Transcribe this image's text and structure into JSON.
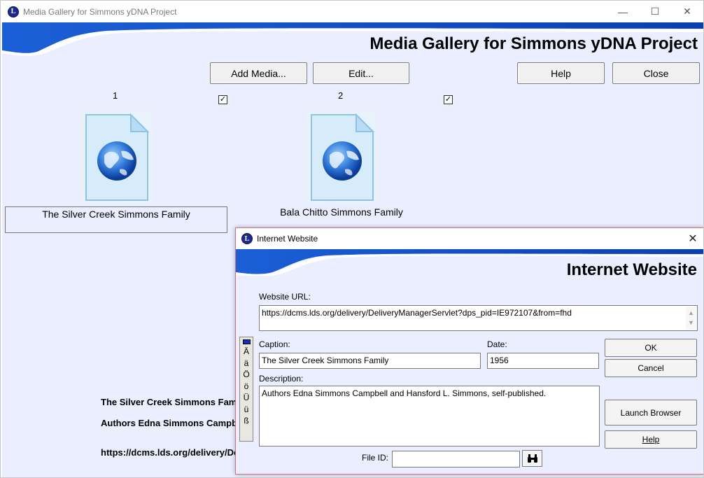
{
  "window": {
    "title": "Media Gallery for Simmons yDNA Project",
    "controls": {
      "minimize": "—",
      "maximize": "☐",
      "close": "✕"
    }
  },
  "gallery": {
    "banner_title": "Media Gallery for Simmons yDNA Project",
    "buttons": {
      "add_media": "Add Media...",
      "edit": "Edit...",
      "help": "Help",
      "close": "Close"
    },
    "items": [
      {
        "number": "1",
        "checked": "✓",
        "icon": "web-document-icon",
        "caption": "The Silver Creek Simmons Family"
      },
      {
        "number": "2",
        "checked": "✓",
        "icon": "web-document-icon",
        "caption": "Bala Chitto Simmons Family"
      }
    ],
    "details": {
      "line1": "The Silver Creek Simmons Family",
      "line2": "Authors Edna Simmons Campbell and Hansford L. Simmons, self-published.",
      "line3": "https://dcms.lds.org/delivery/DeliveryManagerServlet?dps_pid=IE972107&from=fhd"
    }
  },
  "dialog": {
    "title": "Internet Website",
    "banner_title": "Internet Website",
    "close": "✕",
    "url_label": "Website URL:",
    "url_value": "https://dcms.lds.org/delivery/DeliveryManagerServlet?dps_pid=IE972107&from=fhd",
    "caption_label": "Caption:",
    "caption_value": "The Silver Creek Simmons Family",
    "date_label": "Date:",
    "date_value": "1956",
    "description_label": "Description:",
    "description_value": "Authors Edna Simmons Campbell and Hansford L. Simmons, self-published.",
    "file_id_label": "File ID:",
    "file_id_value": "",
    "chars": [
      "Ä",
      "ä",
      "Ö",
      "ö",
      "Ü",
      "ü",
      "ß"
    ],
    "buttons": {
      "ok": "OK",
      "cancel": "Cancel",
      "launch_browser": "Launch Browser",
      "help": "Help"
    },
    "find_icon": "binoculars-icon"
  }
}
